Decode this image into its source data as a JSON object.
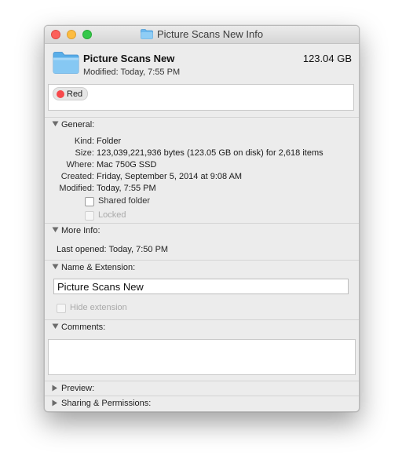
{
  "window": {
    "title": "Picture Scans New Info"
  },
  "item": {
    "name": "Picture Scans New",
    "size": "123.04 GB",
    "modified_line": "Modified: Today, 7:55 PM"
  },
  "tags": [
    {
      "label": "Red",
      "color": "#f7484b"
    }
  ],
  "general": {
    "header": "General:",
    "rows": [
      {
        "key": "Kind:",
        "value": "Folder"
      },
      {
        "key": "Size:",
        "value": "123,039,221,936 bytes (123.05 GB on disk) for 2,618 items"
      },
      {
        "key": "Where:",
        "value": "Mac 750G SSD"
      },
      {
        "key": "Created:",
        "value": "Friday, September 5, 2014 at 9:08 AM"
      },
      {
        "key": "Modified:",
        "value": "Today, 7:55 PM"
      }
    ],
    "shared_folder_label": "Shared folder",
    "locked_label": "Locked"
  },
  "more_info": {
    "header": "More Info:",
    "last_opened": "Last opened: Today, 7:50 PM"
  },
  "name_extension": {
    "header": "Name & Extension:",
    "name_value": "Picture Scans New",
    "hide_extension_label": "Hide extension"
  },
  "comments": {
    "header": "Comments:"
  },
  "preview": {
    "header": "Preview:"
  },
  "sharing": {
    "header": "Sharing & Permissions:"
  },
  "colors": {
    "folder": "#6cb8ee",
    "close": "#fc605b",
    "minimize": "#fdbc40",
    "zoom": "#34c84a"
  }
}
